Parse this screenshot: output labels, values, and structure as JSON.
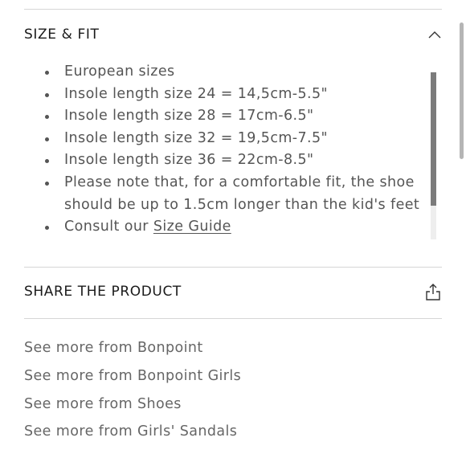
{
  "size_fit": {
    "title": "SIZE & FIT",
    "items": [
      "European sizes",
      "Insole length size 24 = 14,5cm-5.5\"",
      "Insole length size 28 = 17cm-6.5\"",
      "Insole length size 32 = 19,5cm-7.5\"",
      "Insole length size 36 = 22cm-8.5\"",
      "Please note that, for a comfortable fit, the shoe should be up to 1.5cm longer than the kid's feet"
    ],
    "consult_prefix": "Consult our",
    "size_guide_label": "Size Guide",
    "collapse_icon": "chevron-up-icon"
  },
  "share": {
    "title": "SHARE THE PRODUCT",
    "icon": "share-icon"
  },
  "see_more": [
    "See more from Bonpoint",
    "See more from Bonpoint Girls",
    "See more from Shoes",
    "See more from Girls' Sandals"
  ],
  "colors": {
    "text": "#222222",
    "muted_text": "#555555",
    "divider": "#d6d6d6",
    "scroll_thumb": "#7b7b7b"
  }
}
